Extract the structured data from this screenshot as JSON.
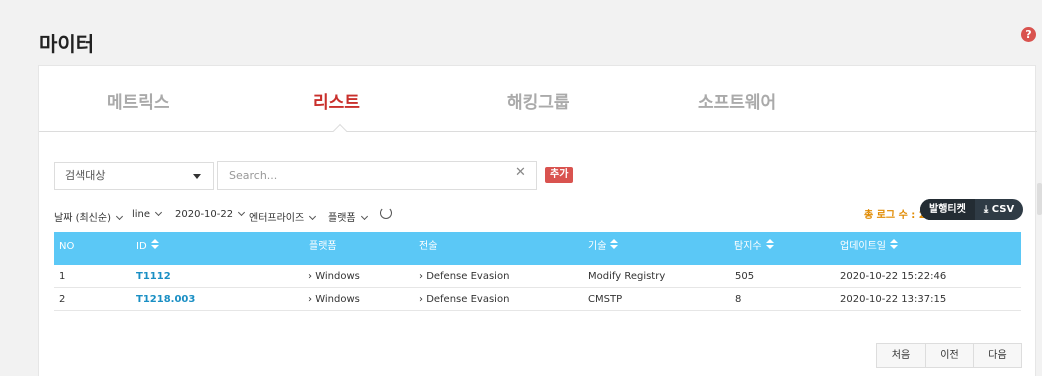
{
  "page": {
    "title": "마이터",
    "help_icon": "question-circle-icon"
  },
  "tabs": [
    {
      "label": "메트릭스",
      "active": false
    },
    {
      "label": "리스트",
      "active": true
    },
    {
      "label": "해킹그룹",
      "active": false
    },
    {
      "label": "소프트웨어",
      "active": false
    }
  ],
  "search": {
    "target_select": "검색대상",
    "placeholder": "Search...",
    "clear_icon": "close-icon",
    "add_label": "추가"
  },
  "filters": {
    "date": "날짜 (최신순)",
    "line": "line",
    "day": "2020-10-22",
    "enterprise": "엔터프라이즈",
    "platform": "플랫폼",
    "refresh_icon": "refresh-icon"
  },
  "toolbar": {
    "total_label": "총 로그 수 : 2",
    "ticket_label": "발행티켓",
    "csv_label": "CSV",
    "download_icon": "download-icon"
  },
  "table": {
    "headers": {
      "no": "NO",
      "id": "ID",
      "platform": "플랫폼",
      "tactic": "전술",
      "technique": "기술",
      "detections": "탐지수",
      "updated": "업데이트일"
    },
    "rows": [
      {
        "no": "1",
        "id": "T1112",
        "platform": "Windows",
        "tactic": "Defense Evasion",
        "technique": "Modify Registry",
        "detections": "505",
        "updated": "2020-10-22 15:22:46"
      },
      {
        "no": "2",
        "id": "T1218.003",
        "platform": "Windows",
        "tactic": "Defense Evasion",
        "technique": "CMSTP",
        "detections": "8",
        "updated": "2020-10-22 13:37:15"
      }
    ]
  },
  "pager": {
    "first": "처음",
    "prev": "이전",
    "next": "다음"
  },
  "colors": {
    "accent": "#c9302c",
    "header": "#5bc8f6",
    "link": "#1a8fc4",
    "badge": "#d9534f",
    "total": "#e08a00"
  }
}
